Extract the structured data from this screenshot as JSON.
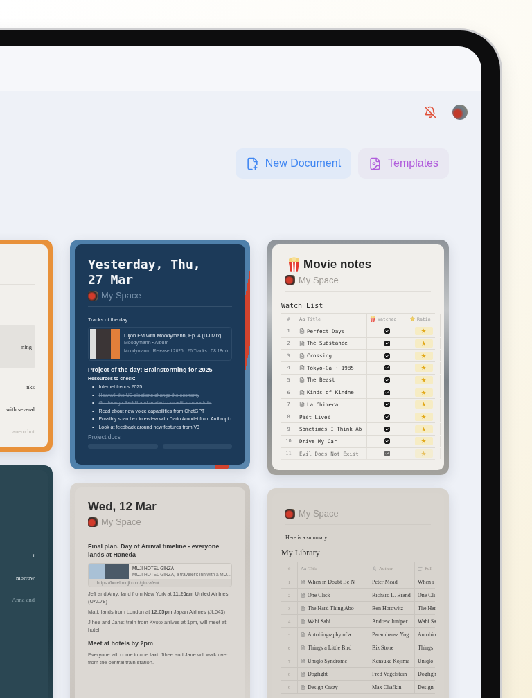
{
  "header": {
    "buttons": [
      {
        "kind": "new-document",
        "label": "New Document"
      },
      {
        "kind": "templates",
        "label": "Templates"
      }
    ]
  },
  "columns": [
    {
      "cards": [
        {
          "kind": "fragment",
          "lines": [
            "ning",
            "nks",
            "with several",
            "anero hot"
          ]
        },
        {
          "kind": "fragment",
          "lines": [
            "t",
            "morrow",
            "Anna and"
          ]
        }
      ]
    },
    {
      "cards": [
        {
          "kind": "journal",
          "title": "Yesterday, Thu, 27 Mar",
          "space": "My Space",
          "tracks_label": "Tracks of the day:",
          "track": {
            "title": "Dijon FM with Moodymann, Ep. 4 (DJ Mix)",
            "subtitle": "Moodymann • Album",
            "meta": [
              "Moodymann",
              "Released 2025",
              "26 Tracks",
              "58:18min"
            ]
          },
          "project": "Project of the day: Brainstorming for 2025",
          "resources_label": "Resources to check:",
          "resources": [
            {
              "marker": "•",
              "text": "Internet trends 2025",
              "done": false
            },
            {
              "marker": "•",
              "text": "How will the US elections change the economy",
              "done": true
            },
            {
              "marker": "•",
              "text": "Go through Reddit and related competitor subreddits",
              "done": true
            },
            {
              "marker": "•",
              "text": "Read about new voice capabilities from ChatGPT",
              "done": false
            },
            {
              "marker": "•",
              "text": "Possibly scan Lex interview with Dario Amodei from Anthropic",
              "done": false
            },
            {
              "marker": "•",
              "text": "Look at feedback around new features from V3",
              "done": false
            }
          ],
          "docs_label": "Project docs"
        },
        {
          "kind": "notes",
          "title": "Wed, 12 Mar",
          "space": "My Space",
          "blocks": [
            {
              "kind": "heading",
              "text": "Final plan. Day of Arrival timeline - everyone lands at Haneda"
            },
            {
              "kind": "bookmark",
              "title": "MUJI HOTEL GINZA",
              "description": "MUJI HOTEL GINZA, a traveler's inn with a MU...",
              "url": "https://hotel.muji.com/ginza/en/"
            },
            {
              "kind": "paragraph",
              "text": "Jeff and Amy: land from New York at **11:20am** United Airlines (UAL78)"
            },
            {
              "kind": "paragraph",
              "text": "Matt: lands from London at **12:05pm** Japan Airlines (JL043)"
            },
            {
              "kind": "paragraph",
              "text": "Jihee and Jane: train from Kyoto arrives at 1pm, will meet at hotel"
            },
            {
              "kind": "heading",
              "text": "Meet at hotels by 2pm"
            },
            {
              "kind": "paragraph",
              "text": "Everyone will come in one taxi. Jihee and Jane will walk over from the central train station."
            }
          ]
        }
      ]
    },
    {
      "cards": [
        {
          "kind": "table",
          "title": "Movie notes",
          "space": "My Space",
          "table_title": "Watch List",
          "columns": [
            {
              "kind": "number",
              "label": "#"
            },
            {
              "kind": "title",
              "prefix": "Aa",
              "label": "Title"
            },
            {
              "kind": "check",
              "label": "Watched"
            },
            {
              "kind": "rating",
              "label": "Ratin"
            }
          ],
          "rows": [
            {
              "num": "1",
              "title": "Perfect Days",
              "page": true,
              "watched": true,
              "rating": "★",
              "faded": false
            },
            {
              "num": "2",
              "title": "The Substance",
              "page": true,
              "watched": true,
              "rating": "★",
              "faded": false
            },
            {
              "num": "3",
              "title": "Crossing",
              "page": true,
              "watched": true,
              "rating": "★",
              "faded": false
            },
            {
              "num": "4",
              "title": "Tokyo-Ga · 1985",
              "page": true,
              "watched": true,
              "rating": "★",
              "faded": false
            },
            {
              "num": "5",
              "title": "The Beast",
              "page": true,
              "watched": true,
              "rating": "★",
              "faded": false
            },
            {
              "num": "6",
              "title": "Kinds of Kindne",
              "page": true,
              "watched": true,
              "rating": "★",
              "faded": false
            },
            {
              "num": "7",
              "title": "La Chimera",
              "page": true,
              "watched": true,
              "rating": "★",
              "faded": false
            },
            {
              "num": "8",
              "title": "Past Lives",
              "page": false,
              "watched": true,
              "rating": "★",
              "faded": false
            },
            {
              "num": "9",
              "title": "Sometimes I Think Ab",
              "page": false,
              "watched": true,
              "rating": "★",
              "faded": false
            },
            {
              "num": "10",
              "title": "Drive My Car",
              "page": false,
              "watched": true,
              "rating": "★",
              "faded": false
            },
            {
              "num": "11",
              "title": "Evil Does Not Exist",
              "page": false,
              "watched": true,
              "rating": "★",
              "faded": true
            }
          ]
        },
        {
          "kind": "library",
          "space": "My Space",
          "intro": "Here is a summary",
          "table_title": "My Library",
          "columns": [
            {
              "kind": "number",
              "label": "#"
            },
            {
              "kind": "title",
              "prefix": "Aa",
              "label": "Title"
            },
            {
              "kind": "person",
              "label": "Author"
            },
            {
              "kind": "text",
              "label": "Full"
            }
          ],
          "rows": [
            {
              "num": "1",
              "title": "When in Doubt Be N",
              "author": "Peter Mead",
              "full": "When i"
            },
            {
              "num": "2",
              "title": "One Click",
              "author": "Richard L. Brand",
              "full": "One Cli"
            },
            {
              "num": "3",
              "title": "The Hard Thing Abo",
              "author": "Ben Horowitz",
              "full": "The Har"
            },
            {
              "num": "4",
              "title": "Wabi Sabi",
              "author": "Andrew Juniper",
              "full": "Wabi Sa"
            },
            {
              "num": "5",
              "title": "Autobiography of a",
              "author": "Paramhansa Yog",
              "full": "Autobio"
            },
            {
              "num": "6",
              "title": "Things a Little Bird",
              "author": "Biz Stone",
              "full": "Things"
            },
            {
              "num": "7",
              "title": "Uniqlo Syndrome",
              "author": "Kensuke Kojima",
              "full": "Uniqlo"
            },
            {
              "num": "8",
              "title": "Dogfight",
              "author": "Fred Vogelstein",
              "full": "Dogfigh"
            },
            {
              "num": "9",
              "title": "Design Crazy",
              "author": "Max Chafkin",
              "full": "Design"
            }
          ]
        }
      ]
    }
  ]
}
